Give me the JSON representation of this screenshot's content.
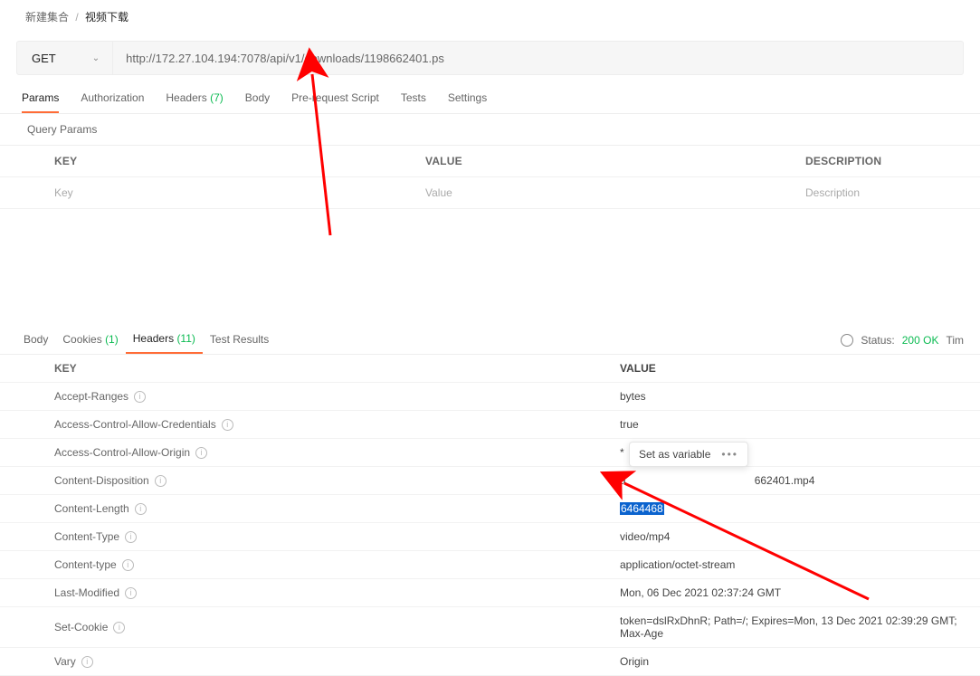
{
  "breadcrumb": {
    "parent": "新建集合",
    "current": "视频下载"
  },
  "request": {
    "method": "GET",
    "url": "http://172.27.104.194:7078/api/v1/downloads/1198662401.ps"
  },
  "reqTabs": {
    "params": "Params",
    "authorization": "Authorization",
    "headers": "Headers",
    "headersCount": "(7)",
    "body": "Body",
    "prereq": "Pre-request Script",
    "tests": "Tests",
    "settings": "Settings"
  },
  "queryParams": {
    "title": "Query Params",
    "header_key": "KEY",
    "header_value": "VALUE",
    "header_desc": "DESCRIPTION",
    "ph_key": "Key",
    "ph_value": "Value",
    "ph_desc": "Description"
  },
  "resTabs": {
    "body": "Body",
    "cookies": "Cookies",
    "cookiesCount": "(1)",
    "headers": "Headers",
    "headersCount": "(11)",
    "testResults": "Test Results",
    "statusLabel": "Status:",
    "statusValue": "200 OK",
    "timeLabel": "Tim"
  },
  "responseHeaders": {
    "header_key": "KEY",
    "header_value": "VALUE",
    "rows": [
      {
        "k": "Accept-Ranges",
        "v": "bytes"
      },
      {
        "k": "Access-Control-Allow-Credentials",
        "v": "true"
      },
      {
        "k": "Access-Control-Allow-Origin",
        "v": "*"
      },
      {
        "k": "Content-Disposition",
        "v_prefix": "a",
        "v_suffix": "662401.mp4"
      },
      {
        "k": "Content-Length",
        "v": "6464468",
        "highlight": true
      },
      {
        "k": "Content-Type",
        "v": "video/mp4"
      },
      {
        "k": "Content-type",
        "v": "application/octet-stream"
      },
      {
        "k": "Last-Modified",
        "v": "Mon, 06 Dec 2021 02:37:24 GMT"
      },
      {
        "k": "Set-Cookie",
        "v": "token=dslRxDhnR; Path=/; Expires=Mon, 13 Dec 2021 02:39:29 GMT; Max-Age"
      },
      {
        "k": "Vary",
        "v": "Origin"
      }
    ]
  },
  "popover": {
    "label": "Set as variable"
  }
}
